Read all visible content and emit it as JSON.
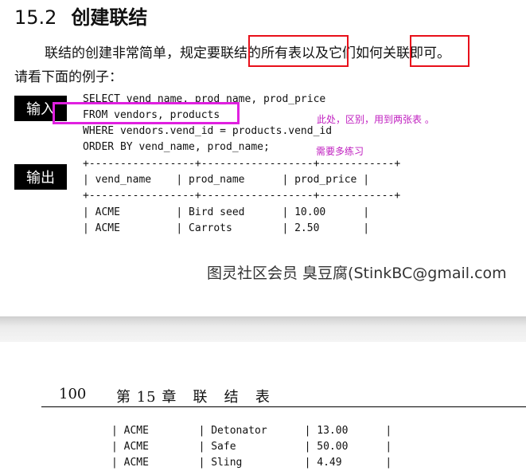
{
  "section": {
    "number": "15.2",
    "title": "创建联结"
  },
  "paragraph": {
    "line1": "联结的创建非常简单，规定要联结的所有表以及它们如何关联即可。",
    "line2": "请看下面的例子："
  },
  "labels": {
    "input": "输入",
    "output": "输出"
  },
  "code": [
    "SELECT vend_name, prod_name, prod_price",
    "FROM vendors, products",
    "WHERE vendors.vend_id = products.vend_id",
    "ORDER BY vend_name, prod_name;"
  ],
  "notes": {
    "note1": "此处，区别，用到两张表 。",
    "note2": "需要多练习"
  },
  "output_table": {
    "border": "+-----------------+------------------+------------+",
    "header": "| vend_name    | prod_name      | prod_price |",
    "rows": [
      "| ACME         | Bird seed      | 10.00      |",
      "| ACME         | Carrots        | 2.50       |"
    ]
  },
  "watermark": "图灵社区会员 臭豆腐(StinkBC@gmail.com",
  "page2": {
    "page_number": "100",
    "chapter_header": "第 15 章   联   结   表",
    "rows": [
      "| ACME        | Detonator      | 13.00      |",
      "| ACME        | Safe           | 50.00      |",
      "| ACME        | Sling          | 4.49       |"
    ]
  },
  "colors": {
    "red_box": "#e8101a",
    "magenta_box": "#e020e0",
    "annotation_text": "#c020c0"
  }
}
